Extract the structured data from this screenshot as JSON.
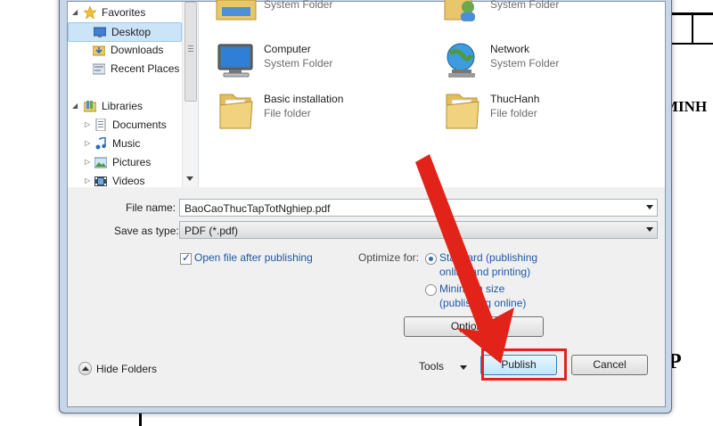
{
  "background_doc": {
    "text_minh": "MINH",
    "text_p": "P"
  },
  "nav": {
    "favorites": "Favorites",
    "items": [
      {
        "label": "Desktop",
        "icon": "desktop-icon",
        "selected": true
      },
      {
        "label": "Downloads",
        "icon": "downloads-folder-icon"
      },
      {
        "label": "Recent Places",
        "icon": "recent-places-icon"
      }
    ],
    "libraries": "Libraries",
    "library_items": [
      {
        "label": "Documents",
        "icon": "documents-icon"
      },
      {
        "label": "Music",
        "icon": "music-icon"
      },
      {
        "label": "Pictures",
        "icon": "pictures-icon"
      },
      {
        "label": "Videos",
        "icon": "videos-icon"
      }
    ]
  },
  "files": [
    {
      "name": "",
      "type": "System Folder",
      "icon": "libraries-folder-icon"
    },
    {
      "name": "",
      "type": "System Folder",
      "icon": "user-folder-icon"
    },
    {
      "name": "Computer",
      "type": "System Folder",
      "icon": "computer-icon"
    },
    {
      "name": "Network",
      "type": "System Folder",
      "icon": "network-icon"
    },
    {
      "name": "Basic installation",
      "type": "File folder",
      "icon": "folder-icon"
    },
    {
      "name": "ThucHanh",
      "type": "File folder",
      "icon": "folder-icon"
    }
  ],
  "form": {
    "file_name_label": "File name:",
    "file_name_value": "BaoCaoThucTapTotNghiep.pdf",
    "save_as_type_label": "Save as type:",
    "save_as_type_value": "PDF (*.pdf)",
    "open_after_publishing": "Open file after publishing",
    "optimize_for_label": "Optimize for:",
    "standard_line1": "Standard (publishing",
    "standard_line2": "online and printing)",
    "minimum_line1": "Minimum size",
    "minimum_line2": "(publishing online)",
    "options_button": "Options..."
  },
  "footer": {
    "hide_folders": "Hide Folders",
    "tools": "Tools",
    "publish": "Publish",
    "cancel": "Cancel"
  },
  "colors": {
    "annotation_red": "#e2231a",
    "link_blue": "#1e5aa8"
  }
}
